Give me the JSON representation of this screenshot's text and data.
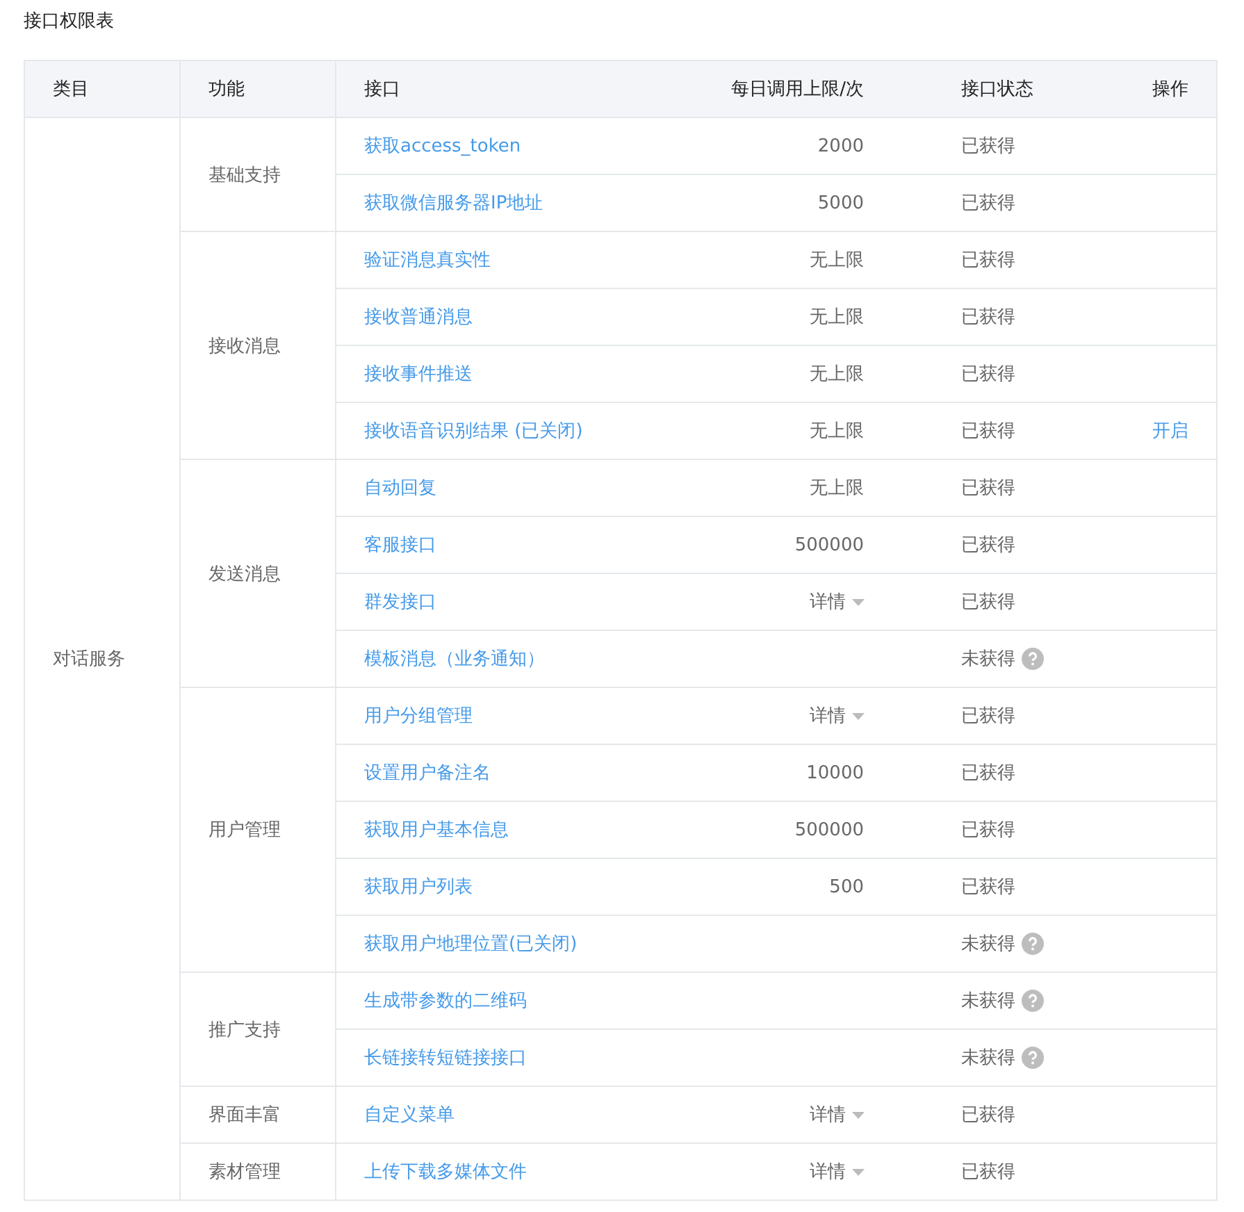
{
  "title": "接口权限表",
  "columns": [
    "类目",
    "功能",
    "接口",
    "每日调用上限/次",
    "接口状态",
    "操作"
  ],
  "categories": [
    {
      "name": "对话服务",
      "functions": [
        {
          "name": "基础支持",
          "rows": [
            {
              "api": "获取access_token",
              "limit": "2000",
              "dropdown": false,
              "status": "已获得",
              "help": false
            },
            {
              "api": "获取微信服务器IP地址",
              "limit": "5000",
              "dropdown": false,
              "status": "已获得",
              "help": false
            }
          ]
        },
        {
          "name": "接收消息",
          "rows": [
            {
              "api": "验证消息真实性",
              "limit": "无上限",
              "dropdown": false,
              "status": "已获得",
              "help": false
            },
            {
              "api": "接收普通消息",
              "limit": "无上限",
              "dropdown": false,
              "status": "已获得",
              "help": false
            },
            {
              "api": "接收事件推送",
              "limit": "无上限",
              "dropdown": false,
              "status": "已获得",
              "help": false
            },
            {
              "api": "接收语音识别结果 (已关闭)",
              "limit": "无上限",
              "dropdown": false,
              "status": "已获得",
              "help": false,
              "action": "开启"
            }
          ]
        },
        {
          "name": "发送消息",
          "rows": [
            {
              "api": "自动回复",
              "limit": "无上限",
              "dropdown": false,
              "status": "已获得",
              "help": false
            },
            {
              "api": "客服接口",
              "limit": "500000",
              "dropdown": false,
              "status": "已获得",
              "help": false
            },
            {
              "api": "群发接口",
              "limit": "详情",
              "dropdown": true,
              "status": "已获得",
              "help": false
            },
            {
              "api": "模板消息（业务通知）",
              "dropdown": false,
              "status": "未获得",
              "help": true
            }
          ]
        },
        {
          "name": "用户管理",
          "rows": [
            {
              "api": "用户分组管理",
              "limit": "详情",
              "dropdown": true,
              "status": "已获得",
              "help": false
            },
            {
              "api": "设置用户备注名",
              "limit": "10000",
              "dropdown": false,
              "status": "已获得",
              "help": false
            },
            {
              "api": "获取用户基本信息",
              "limit": "500000",
              "dropdown": false,
              "status": "已获得",
              "help": false
            },
            {
              "api": "获取用户列表",
              "limit": "500",
              "dropdown": false,
              "status": "已获得",
              "help": false
            },
            {
              "api": "获取用户地理位置(已关闭)",
              "dropdown": false,
              "status": "未获得",
              "help": true
            }
          ]
        },
        {
          "name": "推广支持",
          "rows": [
            {
              "api": "生成带参数的二维码",
              "dropdown": false,
              "status": "未获得",
              "help": true
            },
            {
              "api": "长链接转短链接接口",
              "dropdown": false,
              "status": "未获得",
              "help": true
            }
          ]
        },
        {
          "name": "界面丰富",
          "rows": [
            {
              "api": "自定义菜单",
              "limit": "详情",
              "dropdown": true,
              "status": "已获得",
              "help": false
            }
          ]
        },
        {
          "name": "素材管理",
          "rows": [
            {
              "api": "上传下载多媒体文件",
              "limit": "详情",
              "dropdown": true,
              "status": "已获得",
              "help": false
            }
          ]
        }
      ]
    }
  ]
}
